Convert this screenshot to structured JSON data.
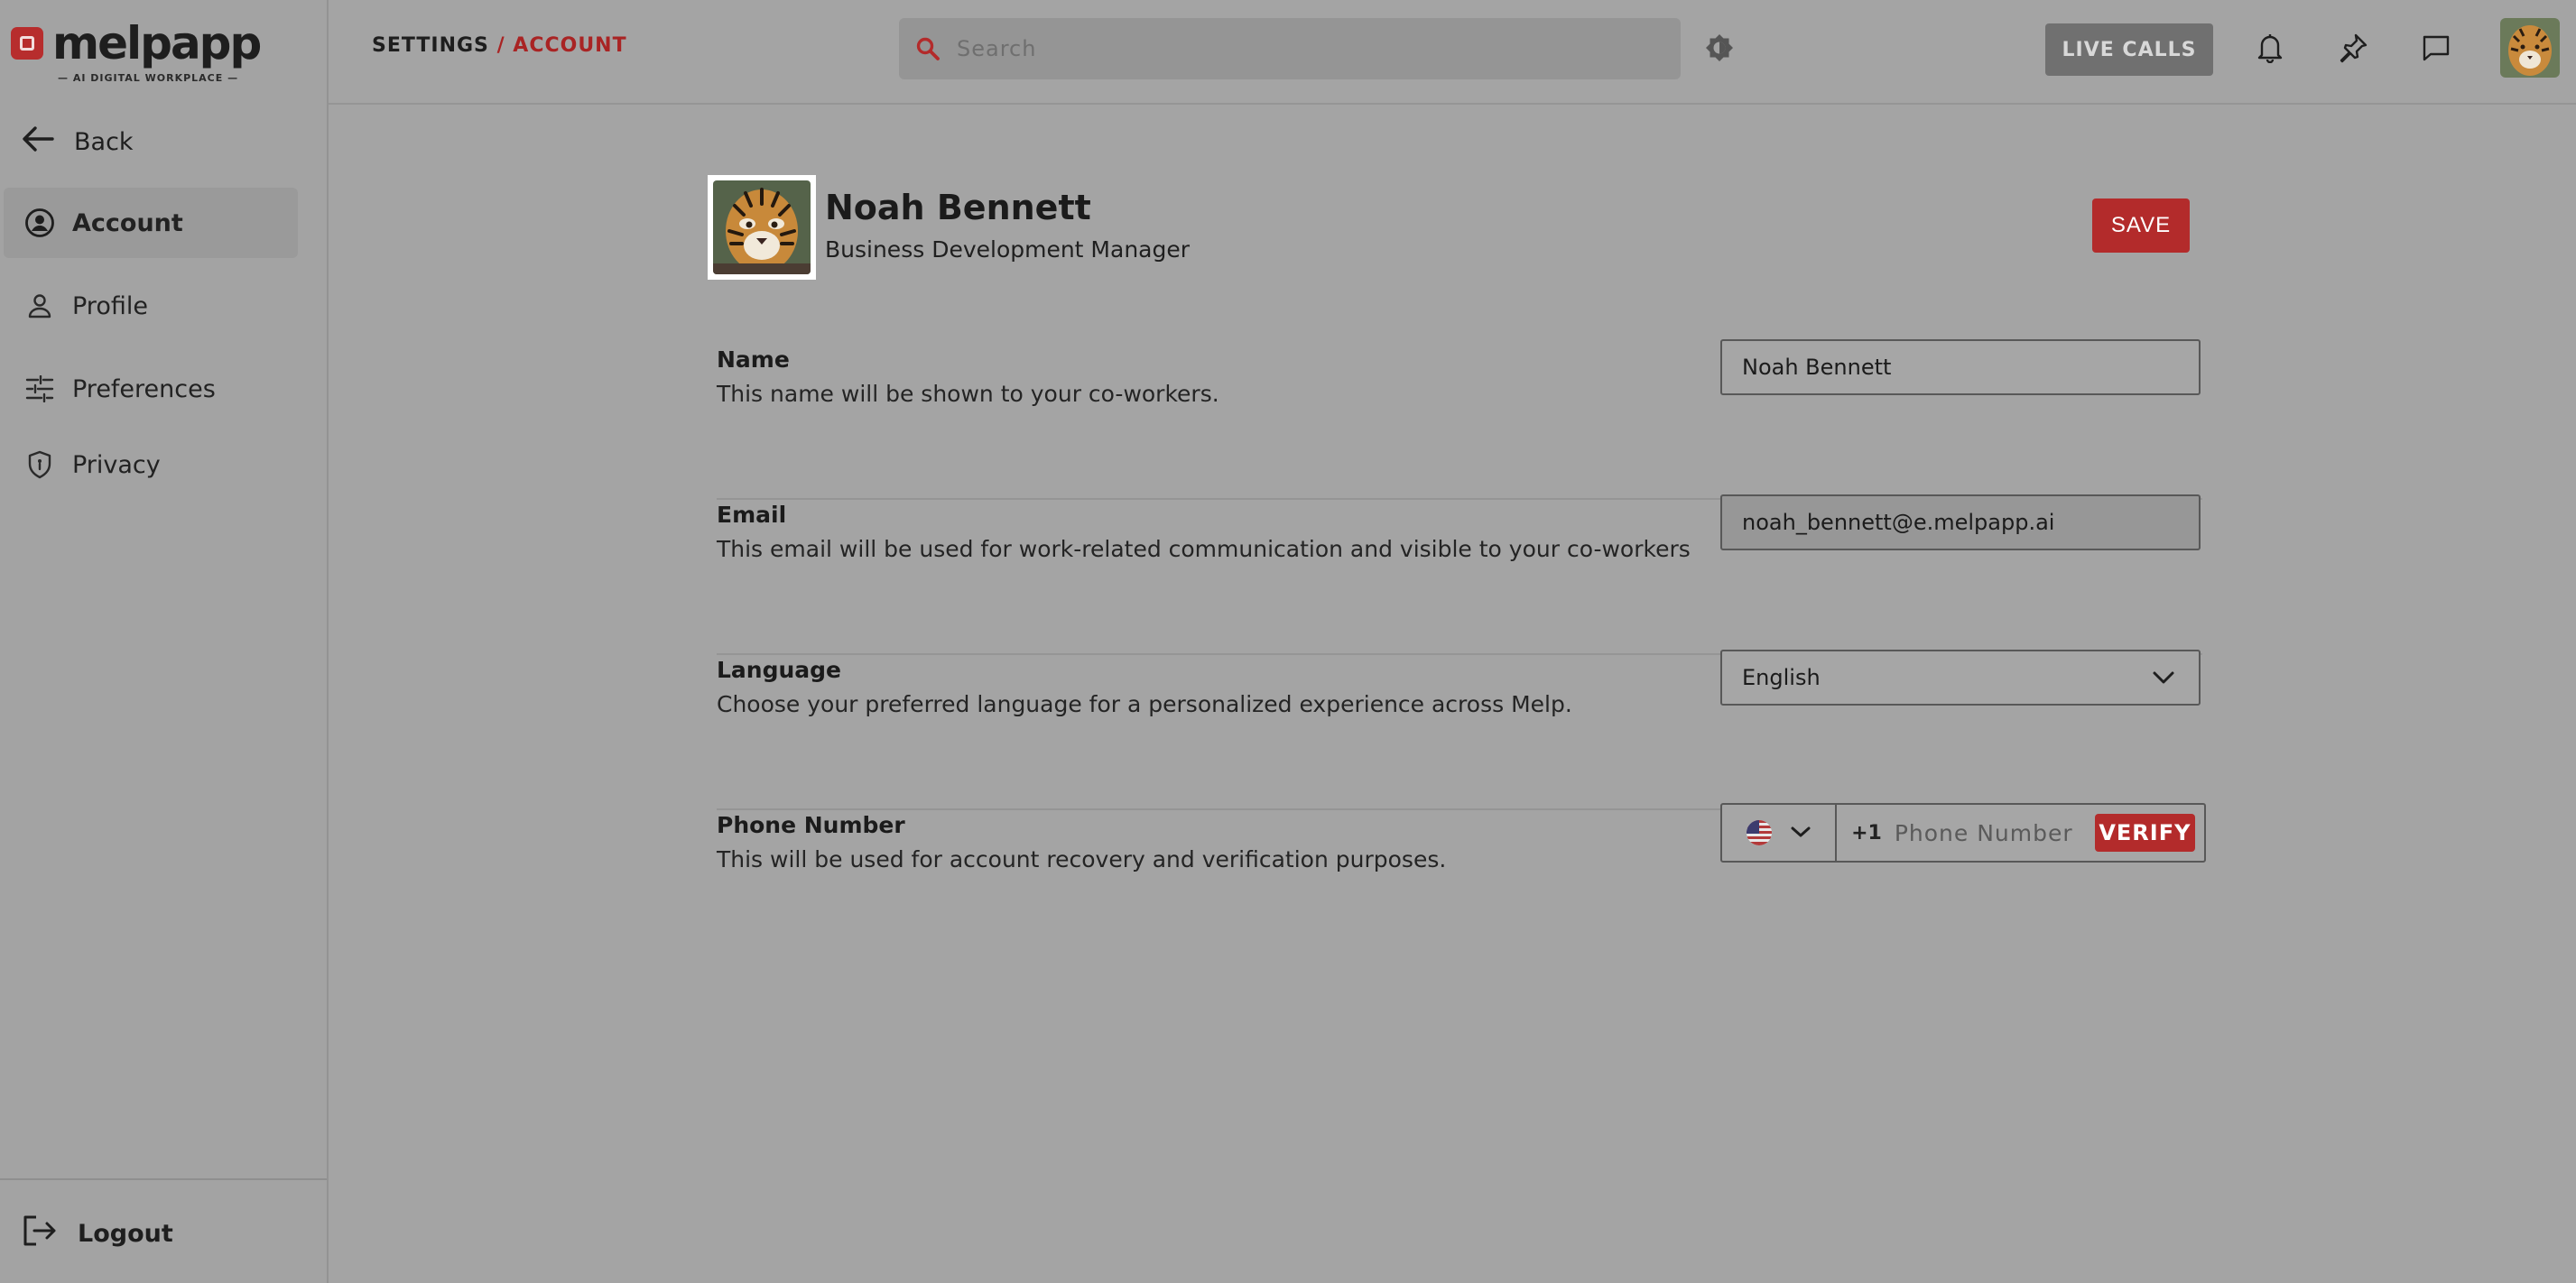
{
  "app": {
    "brand": "melpapp",
    "tagline": "— AI DIGITAL WORKPLACE —"
  },
  "sidebar": {
    "back_label": "Back",
    "items": [
      {
        "label": "Account",
        "icon": "user-circle-icon",
        "active": true
      },
      {
        "label": "Profile",
        "icon": "person-icon",
        "active": false
      },
      {
        "label": "Preferences",
        "icon": "sliders-icon",
        "active": false
      },
      {
        "label": "Privacy",
        "icon": "shield-icon",
        "active": false
      }
    ],
    "logout_label": "Logout"
  },
  "header": {
    "breadcrumb_root": "SETTINGS",
    "breadcrumb_sep": "/",
    "breadcrumb_current": "ACCOUNT",
    "search_placeholder": "Search",
    "live_calls_label": "LIVE CALLS"
  },
  "profile": {
    "name": "Noah Bennett",
    "role": "Business Development Manager",
    "save_label": "SAVE"
  },
  "fields": {
    "name": {
      "label": "Name",
      "description": "This name will be shown to your co-workers.",
      "value": "Noah Bennett"
    },
    "email": {
      "label": "Email",
      "description": "This email will be used for work-related communication and visible to your co-workers",
      "value": "noah_bennett@e.melpapp.ai"
    },
    "language": {
      "label": "Language",
      "description": "Choose your preferred language for a personalized experience across Melp.",
      "value": "English"
    },
    "phone": {
      "label": "Phone Number",
      "description": "This will be used for account recovery and verification purposes.",
      "country_flag": "us-flag-icon",
      "dial_code": "+1",
      "placeholder": "Phone Number",
      "verify_label": "VERIFY"
    }
  },
  "colors": {
    "accent": "#b32b2b",
    "background": "#a4a4a4",
    "live_calls_bg": "#707070"
  }
}
